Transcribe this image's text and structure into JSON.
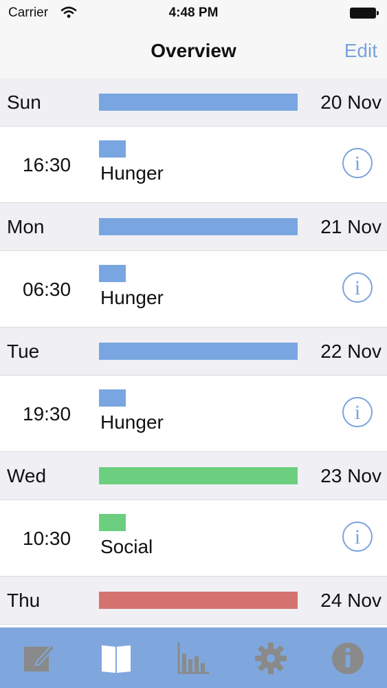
{
  "status": {
    "carrier": "Carrier",
    "time": "4:48 PM"
  },
  "nav": {
    "title": "Overview",
    "edit_label": "Edit"
  },
  "colors": {
    "Hunger": "#79a6e0",
    "Social": "#6ccf7f",
    "red": "#d47370",
    "accent": "#7aa3dc",
    "tab_bar": "#7fa7dd"
  },
  "days": [
    {
      "day": "Sun",
      "date": "20 Nov",
      "bar_color": "#79a6e0",
      "entries": [
        {
          "time": "16:30",
          "label": "Hunger",
          "color": "#79a6e0"
        }
      ]
    },
    {
      "day": "Mon",
      "date": "21 Nov",
      "bar_color": "#79a6e0",
      "entries": [
        {
          "time": "06:30",
          "label": "Hunger",
          "color": "#79a6e0"
        }
      ]
    },
    {
      "day": "Tue",
      "date": "22 Nov",
      "bar_color": "#79a6e0",
      "entries": [
        {
          "time": "19:30",
          "label": "Hunger",
          "color": "#79a6e0"
        }
      ]
    },
    {
      "day": "Wed",
      "date": "23 Nov",
      "bar_color": "#6ccf7f",
      "entries": [
        {
          "time": "10:30",
          "label": "Social",
          "color": "#6ccf7f"
        }
      ]
    },
    {
      "day": "Thu",
      "date": "24 Nov",
      "bar_color": "#d47370",
      "entries": []
    }
  ],
  "info_glyph": "i",
  "tabs": [
    {
      "icon": "compose-icon",
      "active": false
    },
    {
      "icon": "book-icon",
      "active": true
    },
    {
      "icon": "bar-chart-icon",
      "active": false
    },
    {
      "icon": "gear-icon",
      "active": false
    },
    {
      "icon": "info-icon",
      "active": false
    }
  ]
}
